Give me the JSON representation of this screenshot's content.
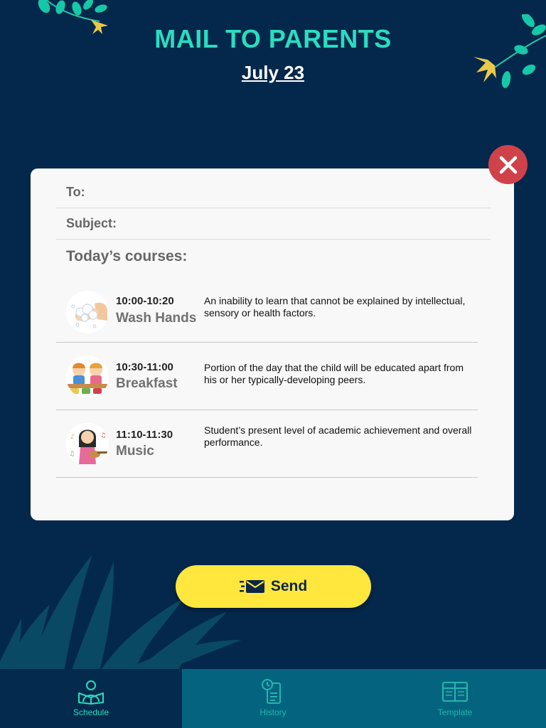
{
  "header": {
    "title": "MAIL TO PARENTS",
    "date": "July 23"
  },
  "mail_form": {
    "to_label": "To:",
    "subject_label": "Subject:",
    "section_title": "Today’s courses:",
    "courses": [
      {
        "time": "10:00-10:20",
        "name": "Wash Hands",
        "description": "An inability to learn that cannot be explained by intellectual, sensory or health factors.",
        "icon": "wash-hands-icon"
      },
      {
        "time": "10:30-11:00",
        "name": "Breakfast",
        "description": "Portion of the day that the child will be educated apart from his or her typically-developing peers.",
        "icon": "breakfast-icon"
      },
      {
        "time": "11:10-11:30",
        "name": "Music",
        "description": "Student’s present level of academic achievement and overall performance.",
        "icon": "music-icon"
      }
    ]
  },
  "actions": {
    "send_label": "Send",
    "close_icon": "close-icon",
    "send_icon": "mail-fast-icon"
  },
  "tabbar": {
    "tabs": [
      {
        "label": "Schedule",
        "icon": "reading-person-icon",
        "active": true
      },
      {
        "label": "History",
        "icon": "clock-document-icon",
        "active": false
      },
      {
        "label": "Template",
        "icon": "template-grid-icon",
        "active": false
      }
    ]
  },
  "colors": {
    "background": "#04284b",
    "title": "#2bdcc0",
    "close_button": "#d0424a",
    "send_button": "#ffe73e",
    "tab_active": "#042a4d",
    "tab_inactive": "#04647f"
  }
}
